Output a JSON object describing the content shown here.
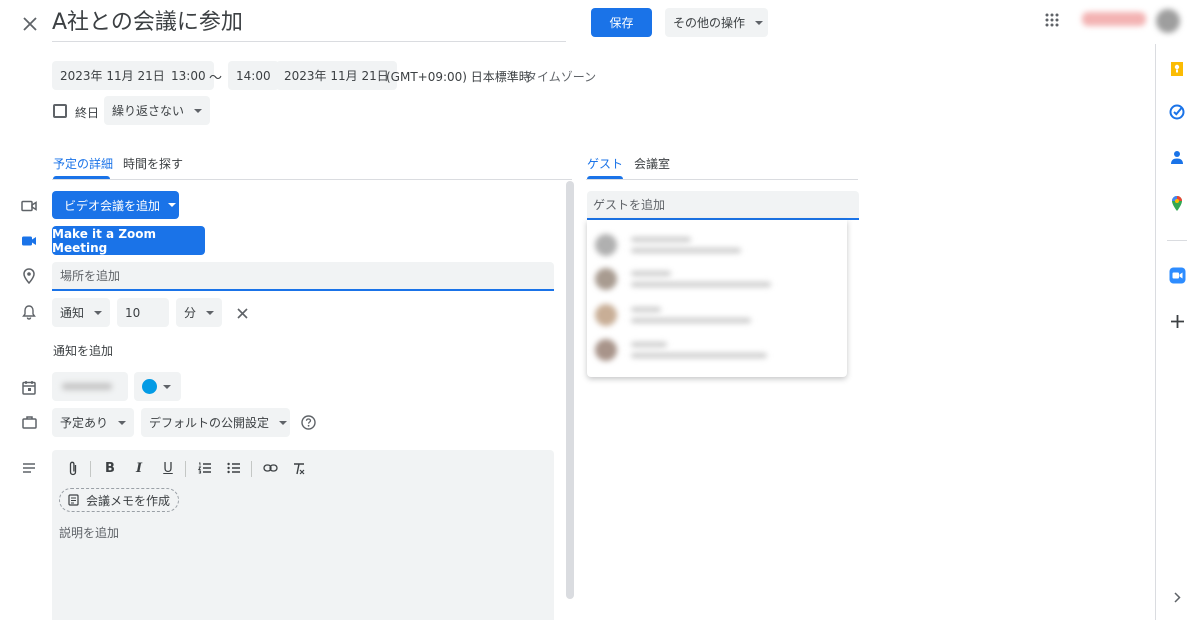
{
  "header": {
    "title": "A社との会議に参加",
    "save_label": "保存",
    "more_actions_label": "その他の操作"
  },
  "datetime": {
    "start_date": "2023年 11月 21日",
    "start_time": "13:00",
    "separator": "〜",
    "end_time": "14:00",
    "end_date": "2023年 11月 21日",
    "timezone": "(GMT+09:00) 日本標準時",
    "timezone_link": "タイムゾーン",
    "all_day_label": "終日",
    "repeat_label": "繰り返さない"
  },
  "left_tabs": [
    {
      "label": "予定の詳細",
      "active": true
    },
    {
      "label": "時間を探す",
      "active": false
    }
  ],
  "right_tabs": [
    {
      "label": "ゲスト",
      "active": true
    },
    {
      "label": "会議室",
      "active": false
    }
  ],
  "details": {
    "video_button_label": "ビデオ会議を追加",
    "zoom_button_label": "Make it a Zoom Meeting",
    "location_placeholder": "場所を追加",
    "notification": {
      "type": "通知",
      "value": "10",
      "unit": "分"
    },
    "add_notification_label": "通知を追加",
    "calendar_color": "#039be5",
    "availability": "予定あり",
    "visibility": "デフォルトの公開設定",
    "meeting_notes_label": "会議メモを作成",
    "description_placeholder": "説明を追加"
  },
  "guests": {
    "placeholder": "ゲストを追加"
  },
  "colors": {
    "accent": "#1a73e8",
    "keep": "#fbbc04",
    "zoom": "#2d8cff"
  },
  "icons": {
    "close": "close-icon",
    "apps": "apps-grid-icon",
    "video": "video-camera-icon",
    "zoom": "zoom-icon",
    "location": "location-pin-icon",
    "bell": "bell-icon",
    "calendar": "calendar-icon",
    "briefcase": "briefcase-icon",
    "description": "text-lines-icon",
    "help": "help-circle-icon",
    "keep": "keep-icon",
    "tasks": "tasks-icon",
    "contacts": "contacts-icon",
    "maps": "maps-icon",
    "add": "plus-icon",
    "expand": "chevron-right-icon"
  }
}
